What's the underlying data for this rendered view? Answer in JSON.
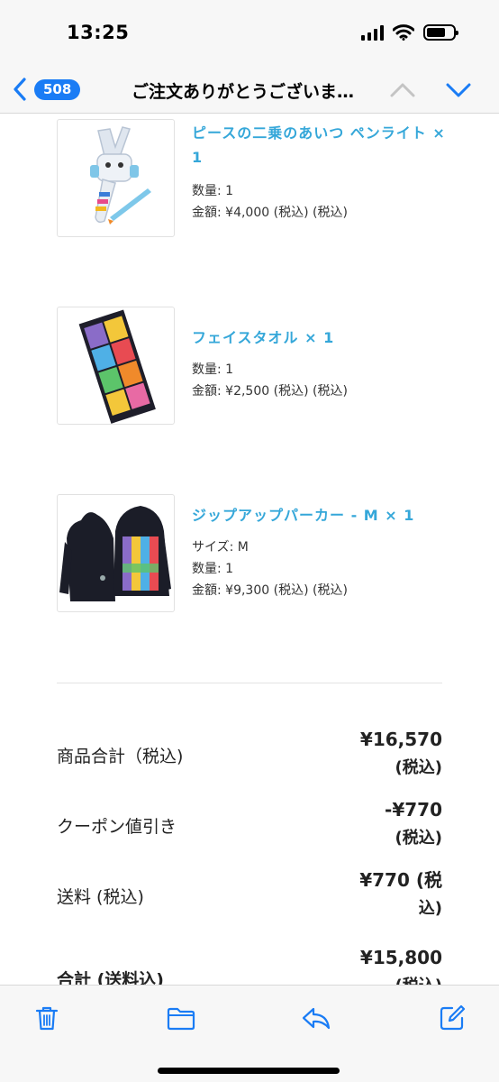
{
  "status_bar": {
    "time": "13:25"
  },
  "nav": {
    "unread_count": "508",
    "title": "ご注文ありがとうございま…"
  },
  "products": [
    {
      "name": "ピースの二乗のあいつ ペンライト × 1",
      "lines": [
        "数量: 1",
        "金額: ¥4,000 (税込) (税込)"
      ],
      "image": "penlight-image"
    },
    {
      "name": "フェイスタオル × 1",
      "lines": [
        "数量: 1",
        "金額: ¥2,500 (税込) (税込)"
      ],
      "image": "face-towel-image"
    },
    {
      "name": "ジップアップパーカー - M × 1",
      "lines": [
        "サイズ: M",
        "数量: 1",
        "金額: ¥9,300 (税込) (税込)"
      ],
      "image": "hoodie-image"
    }
  ],
  "summary": {
    "subtotal_label": "商品合計（税込)",
    "subtotal_value_1": "¥16,570",
    "subtotal_value_2": "(税込)",
    "coupon_label": "クーポン値引き",
    "coupon_value_1": "-¥770",
    "coupon_value_2": "(税込)",
    "shipping_label": "送料 (税込)",
    "shipping_value_1": "¥770 (税",
    "shipping_value_2": "込)",
    "total_label": "合計 (送料込)",
    "total_value_1": "¥15,800",
    "total_value_2": "(税込)"
  },
  "colors": {
    "accent": "#1a7cf5",
    "product_name": "#35a7d9",
    "bar_background": "#f7f7f7"
  },
  "toolbar": {
    "icons": [
      "trash-icon",
      "folder-icon",
      "reply-icon",
      "compose-icon"
    ]
  }
}
